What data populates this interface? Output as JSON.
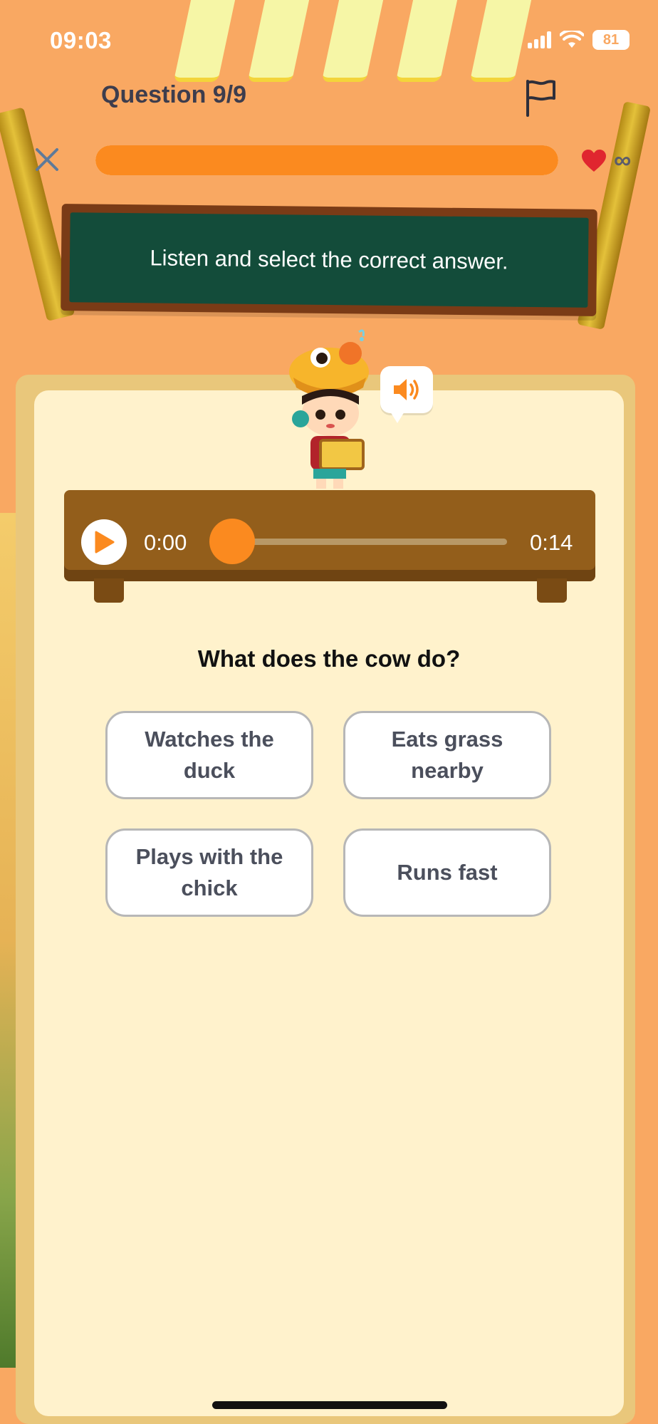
{
  "status_bar": {
    "time": "09:03",
    "battery": "81",
    "icons": [
      "signal-icon",
      "wifi-icon",
      "battery-icon"
    ]
  },
  "header": {
    "question_counter": "Question 9/9",
    "progress": 1.0,
    "lives": "∞",
    "icons": [
      "close-icon",
      "flag-icon",
      "heart-icon"
    ]
  },
  "instruction": "Listen and select the correct answer.",
  "audio_player": {
    "current_time": "0:00",
    "total_time": "0:14",
    "position": 0.0
  },
  "question": "What does the cow do?",
  "options": [
    {
      "label": "Watches the duck"
    },
    {
      "label": "Eats grass nearby"
    },
    {
      "label": "Plays with the chick"
    },
    {
      "label": "Runs fast"
    }
  ],
  "colors": {
    "background": "#f9a862",
    "accent": "#fb8a1f",
    "board": "#134c3a",
    "card": "#fff2cc",
    "bench": "#935e1b"
  }
}
